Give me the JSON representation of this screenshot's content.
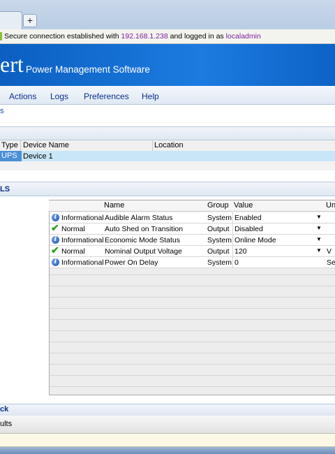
{
  "browser": {
    "new_tab": "+",
    "secure_prefix": "Secure connection established with ",
    "host": "192.168.1.238",
    "secure_mid": " and logged in as ",
    "user": "localadmin"
  },
  "header": {
    "logo_fragment": "ert",
    "subtitle": "Power Management Software"
  },
  "menu": {
    "actions": "Actions",
    "logs": "Logs",
    "preferences": "Preferences",
    "help": "Help"
  },
  "breadcrumb": "s",
  "devices": {
    "columns": [
      "Type",
      "Device Name",
      "Location"
    ],
    "rows": [
      {
        "type": "UPS",
        "name": "Device 1",
        "location": ""
      }
    ]
  },
  "controls": {
    "section_title": "LS",
    "columns": [
      "Name",
      "Group",
      "Value",
      "Un"
    ],
    "rows": [
      {
        "status": "Informational",
        "icon": "info-icon",
        "name": "Audible Alarm Status",
        "group": "System",
        "value": "Enabled",
        "dropdown": true,
        "unit": ""
      },
      {
        "status": "Normal",
        "icon": "check-icon",
        "name": "Auto Shed on Transition",
        "group": "Output",
        "value": "Disabled",
        "dropdown": true,
        "unit": ""
      },
      {
        "status": "Informational",
        "icon": "info-icon",
        "name": "Economic Mode Status",
        "group": "System",
        "value": "Online Mode",
        "dropdown": true,
        "unit": ""
      },
      {
        "status": "Normal",
        "icon": "check-icon",
        "name": "Nominal Output Voltage",
        "group": "Output",
        "value": "120",
        "dropdown": true,
        "unit": "V"
      },
      {
        "status": "Informational",
        "icon": "info-icon",
        "name": "Power On Delay",
        "group": "System",
        "value": "0",
        "dropdown": false,
        "unit": "Se"
      }
    ]
  },
  "bottom": {
    "section_title": "ck",
    "results_tab": "ults"
  },
  "colors": {
    "banner": "#1c7be0",
    "link": "#0a2f88",
    "purple": "#7a1fa2",
    "selected_row": "#c8e6f7"
  }
}
